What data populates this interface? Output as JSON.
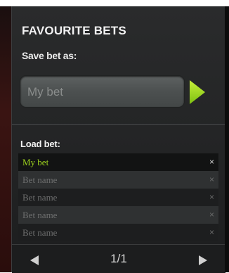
{
  "panel": {
    "title": "FAVOURITE BETS",
    "save_label": "Save bet as:",
    "input_placeholder": "My bet",
    "input_value": "",
    "load_label": "Load bet:",
    "bets": [
      {
        "name": "My bet",
        "active": true,
        "remove": "×"
      },
      {
        "name": "Bet name",
        "active": false,
        "remove": "×"
      },
      {
        "name": "Bet name",
        "active": false,
        "remove": "×"
      },
      {
        "name": "Bet name",
        "active": false,
        "remove": "×"
      },
      {
        "name": "Bet name",
        "active": false,
        "remove": "×"
      }
    ],
    "page_indicator": "1/1"
  },
  "icons": {
    "save": "play-arrow-icon",
    "prev": "triangle-left-icon",
    "next": "triangle-right-icon",
    "remove": "close-icon"
  },
  "colors": {
    "accent": "#9fd51e",
    "panel_bg": "#252627",
    "text": "#f2f2f2"
  }
}
